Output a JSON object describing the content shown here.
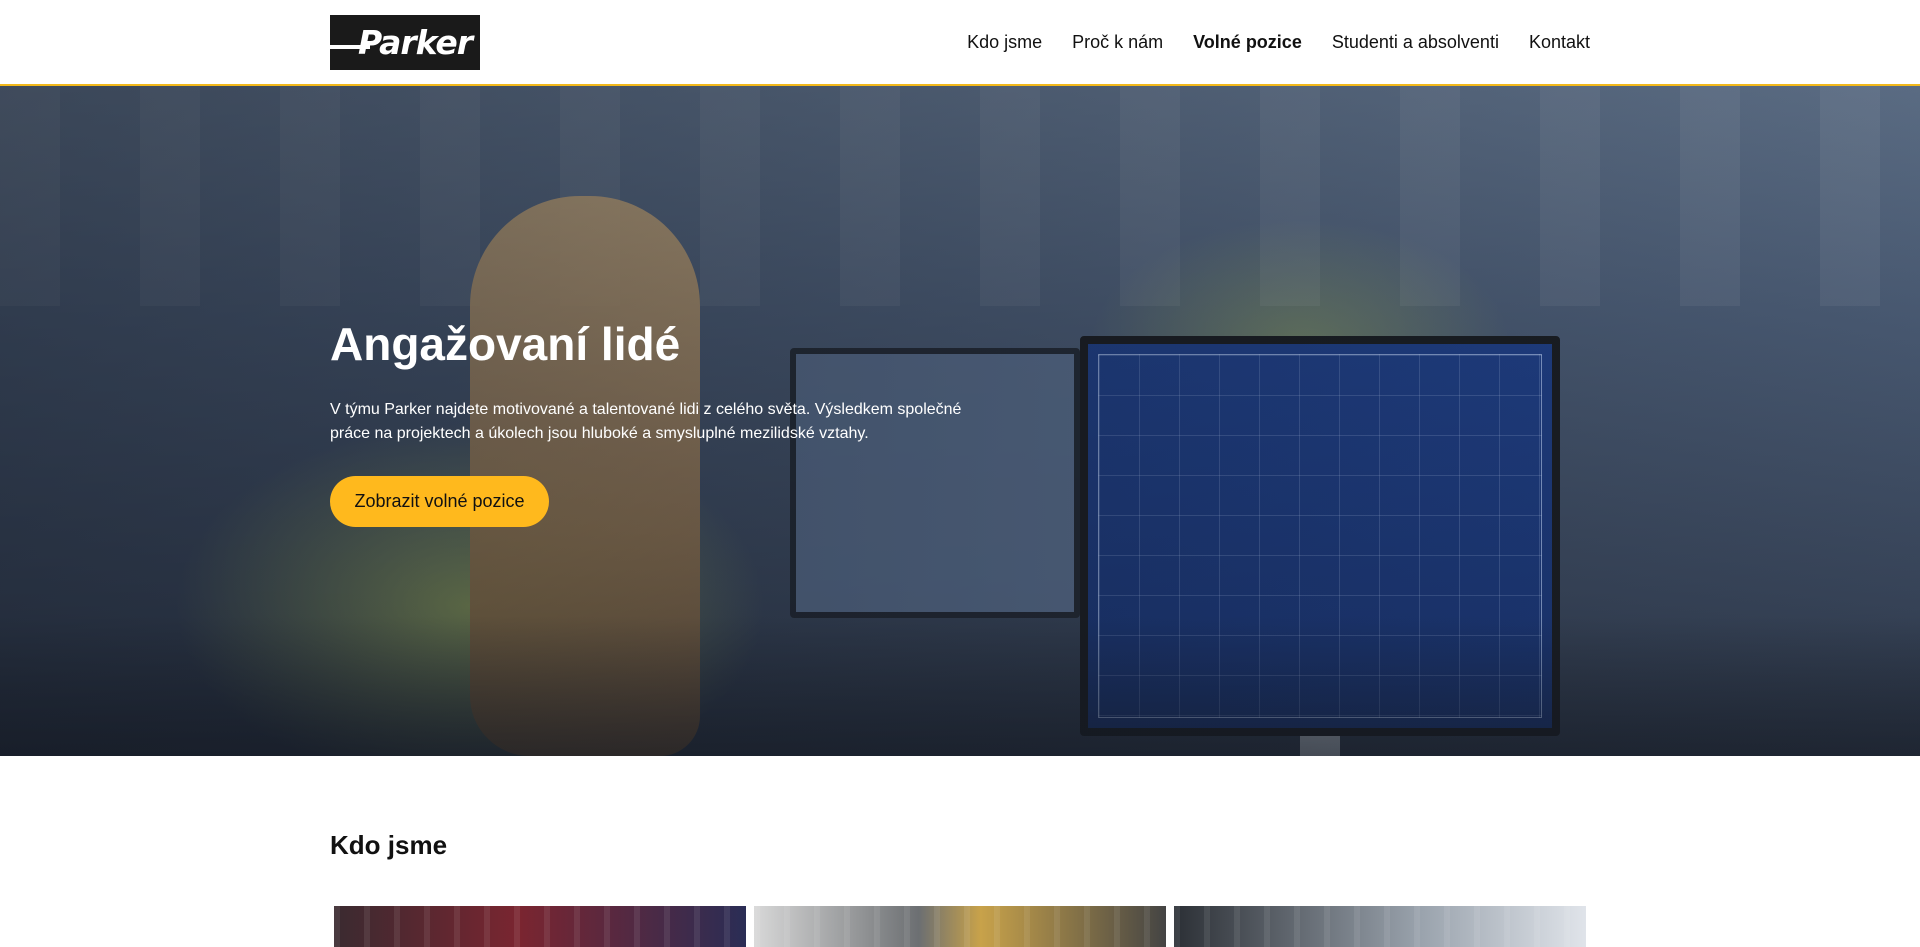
{
  "header": {
    "logo_text": "Parker",
    "nav": [
      {
        "label": "Kdo jsme"
      },
      {
        "label": "Proč k nám"
      },
      {
        "label": "Volné pozice"
      },
      {
        "label": "Studenti a absolventi"
      },
      {
        "label": "Kontakt"
      }
    ]
  },
  "hero": {
    "title": "Angažovaní lidé",
    "text": "V týmu Parker najdete motivované a talentované lidi z celého světa. Výsledkem společné práce na projektech a úkolech jsou hluboké a smysluplné mezilidské vztahy.",
    "button_label": "Zobrazit volné pozice"
  },
  "section": {
    "title": "Kdo jsme"
  },
  "colors": {
    "accent": "#ffb91d",
    "header_border": "#f2b81a",
    "logo_bg": "#1a1a1a"
  }
}
